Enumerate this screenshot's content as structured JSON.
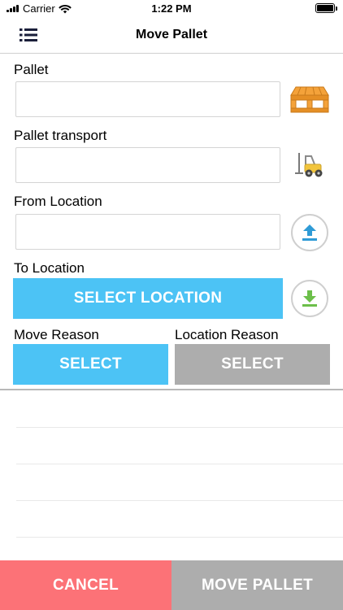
{
  "status_bar": {
    "carrier": "Carrier",
    "time": "1:22 PM"
  },
  "nav": {
    "title": "Move Pallet",
    "menu_icon": "list-icon"
  },
  "form": {
    "pallet": {
      "label": "Pallet",
      "value": "",
      "placeholder": "",
      "icon": "pallet-icon"
    },
    "pallet_transport": {
      "label": "Pallet transport",
      "value": "",
      "placeholder": "",
      "icon": "forklift-icon"
    },
    "from_location": {
      "label": "From Location",
      "value": "",
      "placeholder": "",
      "icon": "upload-arrow-icon"
    },
    "to_location": {
      "label": "To Location",
      "button_label": "SELECT LOCATION",
      "icon": "download-arrow-icon"
    },
    "move_reason": {
      "label": "Move Reason",
      "button_label": "SELECT"
    },
    "location_reason": {
      "label": "Location Reason",
      "button_label": "SELECT"
    }
  },
  "footer": {
    "cancel_label": "CANCEL",
    "move_label": "MOVE PALLET"
  },
  "colors": {
    "primary_blue": "#4cc3f5",
    "disabled_gray": "#adadad",
    "cancel_red": "#fc7277",
    "pallet_orange": "#f4a23a",
    "upload_blue": "#2f9bd6",
    "download_green": "#6cbf4a"
  }
}
